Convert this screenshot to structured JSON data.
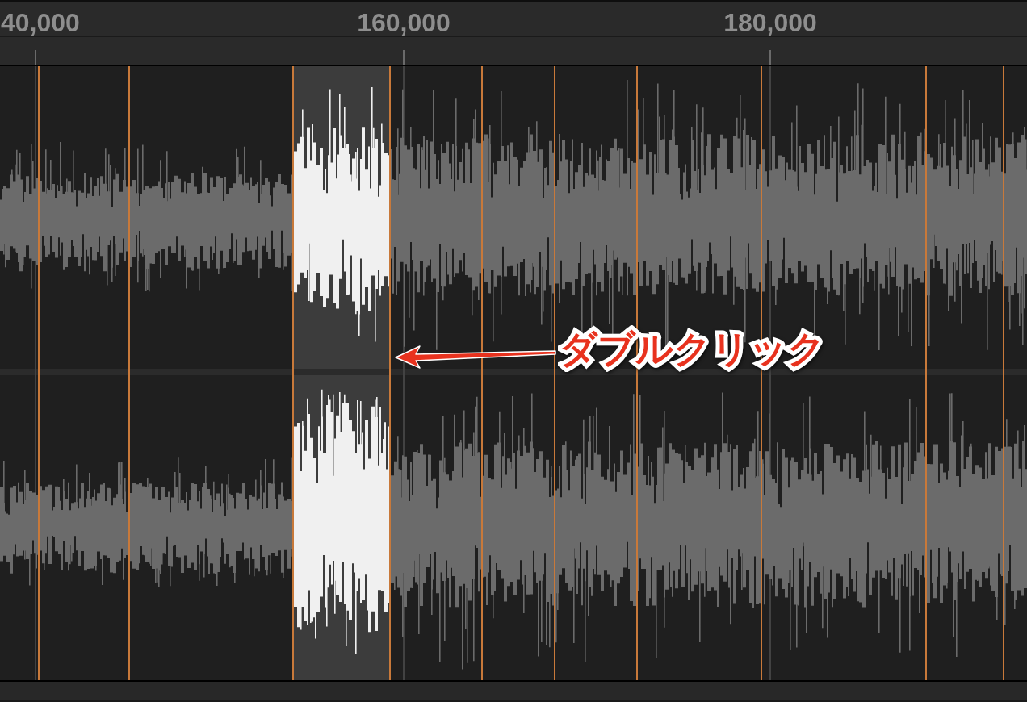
{
  "ruler": {
    "labels": [
      "40,000",
      "160,000",
      "180,000"
    ]
  },
  "waveform": {
    "slices": [
      {
        "selected": false
      },
      {
        "selected": false
      },
      {
        "selected": false
      },
      {
        "selected": true
      },
      {
        "selected": false
      },
      {
        "selected": false
      },
      {
        "selected": false
      },
      {
        "selected": false
      },
      {
        "selected": false
      },
      {
        "selected": false
      },
      {
        "selected": false
      }
    ]
  },
  "annotation": {
    "text": "ダブルクリック"
  }
}
